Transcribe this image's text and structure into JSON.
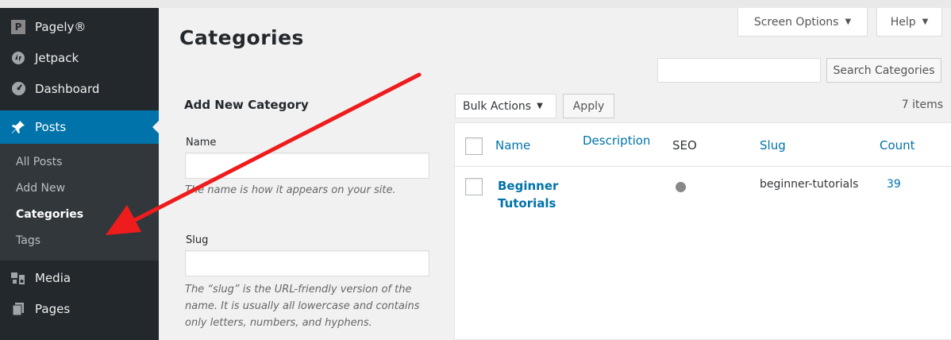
{
  "sidebar": {
    "items": [
      {
        "label": "Pagely®",
        "icon": "pagely-icon"
      },
      {
        "label": "Jetpack",
        "icon": "jetpack-icon"
      },
      {
        "label": "Dashboard",
        "icon": "dashboard-icon"
      },
      {
        "label": "Posts",
        "icon": "pin-icon"
      },
      {
        "label": "Media",
        "icon": "media-icon"
      },
      {
        "label": "Pages",
        "icon": "pages-icon"
      }
    ],
    "posts_submenu": [
      "All Posts",
      "Add New",
      "Categories",
      "Tags"
    ]
  },
  "header": {
    "screen_options": "Screen Options",
    "help": "Help",
    "page_title": "Categories"
  },
  "search": {
    "button": "Search Categories",
    "value": ""
  },
  "form": {
    "title": "Add New Category",
    "name_label": "Name",
    "name_value": "",
    "name_desc": "The name is how it appears on your site.",
    "slug_label": "Slug",
    "slug_value": "",
    "slug_desc": "The “slug” is the URL-friendly version of the name. It is usually all lowercase and contains only letters, numbers, and hyphens."
  },
  "list": {
    "bulk_actions": "Bulk Actions",
    "apply": "Apply",
    "count": "7 items",
    "columns": {
      "name": "Name",
      "description": "Description",
      "seo": "SEO",
      "slug": "Slug",
      "count": "Count"
    },
    "rows": [
      {
        "name": "Beginner Tutorials",
        "description": "",
        "slug": "beginner-tutorials",
        "count": "39"
      }
    ]
  },
  "colors": {
    "sidebar_bg": "#23282d",
    "active_menu": "#0073aa",
    "link": "#0073aa",
    "annotation_arrow": "#ee1c1c"
  }
}
